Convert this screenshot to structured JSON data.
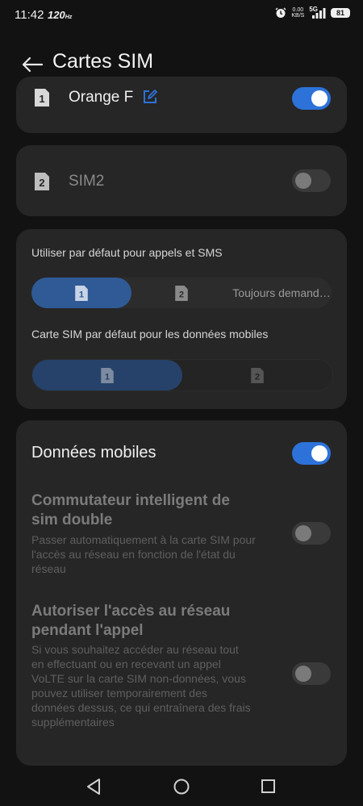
{
  "status_bar": {
    "time": "11:42",
    "refresh_rate": "120",
    "net_speed_value": "0.00",
    "net_speed_unit": "KB/S",
    "network_type": "5G",
    "battery": "81",
    "icons": [
      "alarm-icon",
      "signal-icon",
      "battery-icon"
    ]
  },
  "header": {
    "title": "Cartes SIM",
    "back_icon": "arrow-left-icon"
  },
  "sim1": {
    "name": "Orange F",
    "enabled": true,
    "slot_badge": "1"
  },
  "sim2": {
    "name": "SIM2",
    "enabled": false,
    "slot_badge": "2"
  },
  "defaults": {
    "calls_label": "Utiliser par défaut pour appels et SMS",
    "calls_options": [
      "1",
      "2",
      "Toujours demand…"
    ],
    "calls_selected": "1",
    "data_label": "Carte SIM par défaut pour les données mobiles",
    "data_options": [
      "1",
      "2"
    ],
    "data_selected": "1"
  },
  "mobile_data": {
    "title": "Données mobiles",
    "enabled": true,
    "smart_switch_title": "Commutateur intelligent de sim double",
    "smart_switch_desc": "Passer automatiquement à la carte SIM pour l'accès au réseau en fonction de l'état du réseau",
    "smart_switch_enabled": false,
    "in_call_title": "Autoriser l'accès au réseau pendant l'appel",
    "in_call_desc": "Si vous souhaitez accéder au réseau tout en effectuant ou en recevant un appel VoLTE sur la carte SIM non-données, vous pouvez utiliser temporairement des données dessus, ce qui entraînera des frais supplémentaires",
    "in_call_enabled": false
  },
  "colors": {
    "accent": "#2d72d9",
    "card_bg": "#262626",
    "page_bg": "#121212"
  },
  "nav_bar": {
    "icons": [
      "back-triangle-icon",
      "home-circle-icon",
      "recents-square-icon"
    ]
  }
}
